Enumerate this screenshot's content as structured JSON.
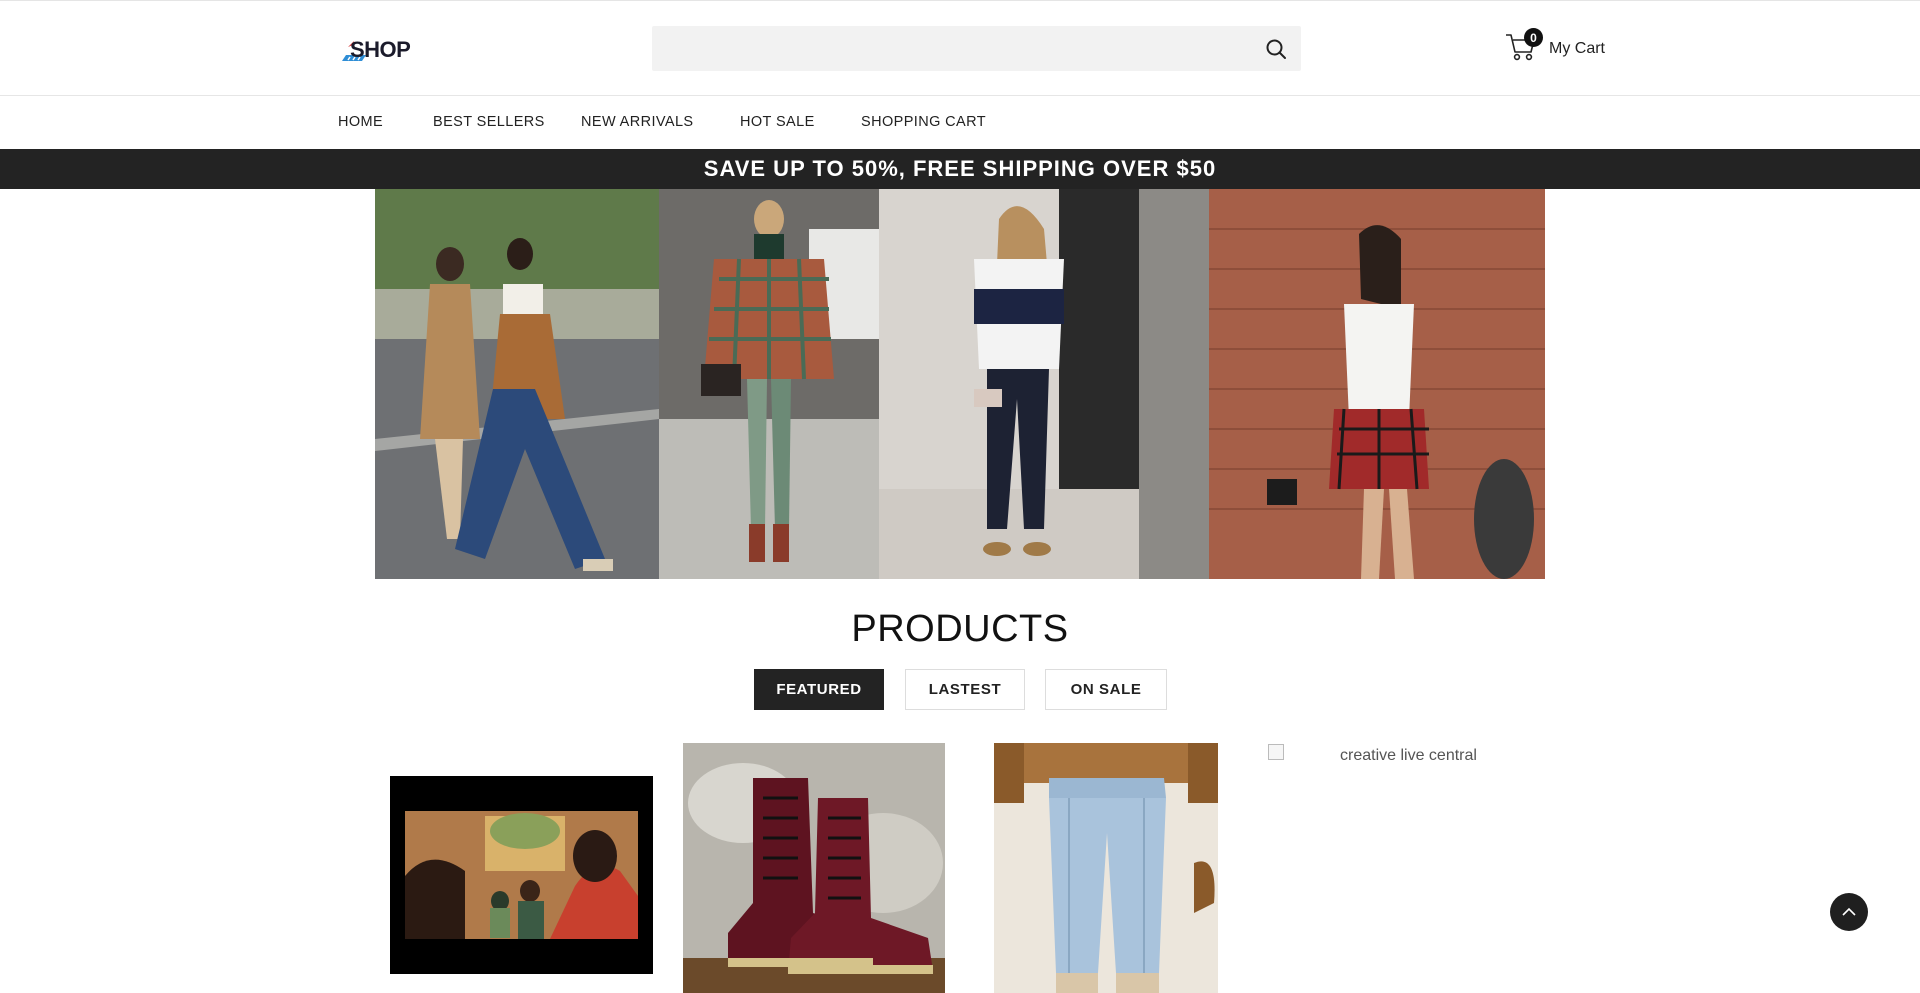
{
  "header": {
    "logo_text": "SHOP",
    "search": {
      "placeholder": "",
      "value": ""
    },
    "cart": {
      "count": "0",
      "label": "My Cart"
    }
  },
  "nav": {
    "items": [
      {
        "label": "HOME"
      },
      {
        "label": "BEST SELLERS"
      },
      {
        "label": "NEW ARRIVALS"
      },
      {
        "label": "HOT SALE"
      },
      {
        "label": "SHOPPING CART"
      }
    ]
  },
  "promo": {
    "text": "SAVE UP TO 50%, FREE SHIPPING OVER $50"
  },
  "products": {
    "title": "PRODUCTS",
    "tabs": [
      {
        "label": "FEATURED",
        "active": true
      },
      {
        "label": "LASTEST",
        "active": false
      },
      {
        "label": "ON SALE",
        "active": false
      }
    ],
    "broken_image_alt": "creative live central"
  },
  "colors": {
    "dark": "#232323",
    "search_bg": "#f2f2f2",
    "logo_blue": "#2f8ed6"
  }
}
